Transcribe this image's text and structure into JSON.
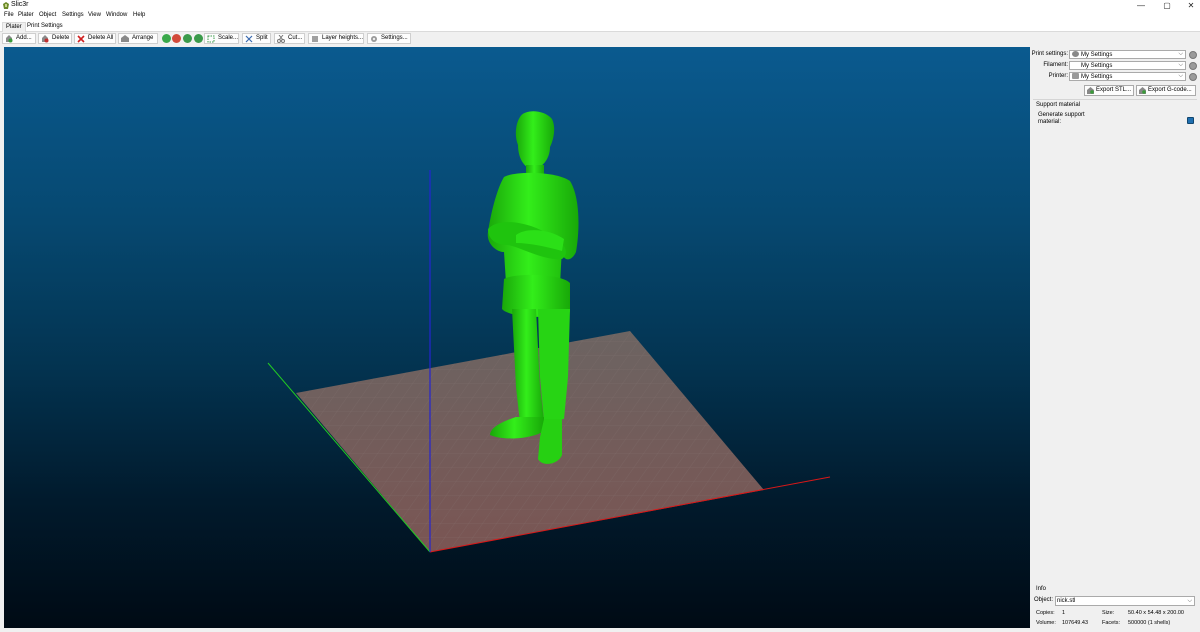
{
  "window": {
    "title": "Slic3r",
    "min_glyph": "—",
    "max_glyph": "▢",
    "close_glyph": "✕"
  },
  "menu": [
    "File",
    "Plater",
    "Object",
    "Settings",
    "View",
    "Window",
    "Help"
  ],
  "tabs": [
    "Plater",
    "Print Settings"
  ],
  "toolbar": {
    "add": "Add...",
    "delete": "Delete",
    "delete_all": "Delete All",
    "arrange": "Arrange",
    "scale": "Scale...",
    "split": "Split",
    "cut": "Cut...",
    "layer_heights": "Layer heights...",
    "settings": "Settings..."
  },
  "panel": {
    "print_settings_label": "Print settings:",
    "print_settings_value": "My Settings",
    "filament_label": "Filament:",
    "filament_value": "My Settings",
    "printer_label": "Printer:",
    "printer_value": "My Settings",
    "export_stl": "Export STL...",
    "export_gcode": "Export G-code...",
    "support_title": "Support material",
    "support_label": "Generate support material:",
    "support_checked": true
  },
  "info": {
    "title": "Info",
    "object_label": "Object:",
    "object_value": "nick.stl",
    "copies_label": "Copies:",
    "copies_value": "1",
    "size_label": "Size:",
    "size_value": "50.40 x 54.48 x 200.00",
    "volume_label": "Volume:",
    "volume_value": "107649.43",
    "facets_label": "Facets:",
    "facets_value": "500000 (1 shells)"
  },
  "colors": {
    "model": "#22dd11",
    "bed": "#6e5a58",
    "axis_x": "#d81818",
    "axis_y": "#22cc22",
    "axis_z": "#2424d0"
  }
}
